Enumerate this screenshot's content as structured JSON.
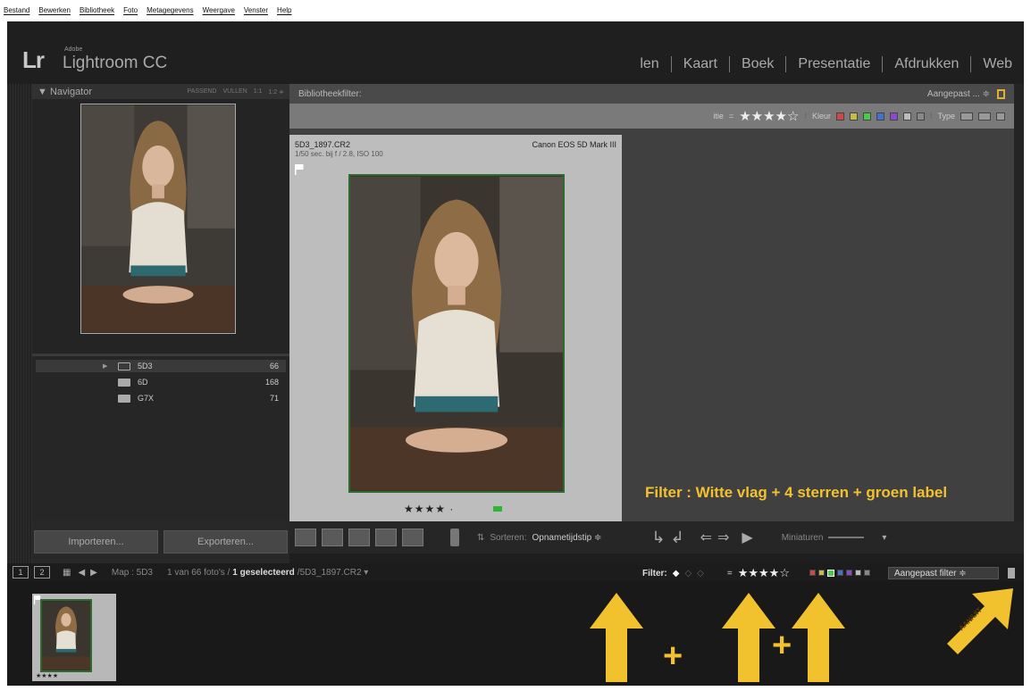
{
  "menu": [
    "Bestand",
    "Bewerken",
    "Bibliotheek",
    "Foto",
    "Metagegevens",
    "Weergave",
    "Venster",
    "Help"
  ],
  "app": {
    "logo": "Lr",
    "adobe": "Adobe",
    "name": "Lightroom CC"
  },
  "modules": [
    "len",
    "Kaart",
    "Boek",
    "Presentatie",
    "Afdrukken",
    "Web"
  ],
  "navigator": {
    "title": "▼ Navigator",
    "opts": [
      "PASSEND",
      "VULLEN",
      "1:1",
      "1:2 ≑"
    ]
  },
  "folders": [
    {
      "name": "5D3",
      "count": "66"
    },
    {
      "name": "6D",
      "count": "168"
    },
    {
      "name": "G7X",
      "count": "71"
    }
  ],
  "buttons": {
    "import": "Importeren...",
    "export": "Exporteren..."
  },
  "filterbar": {
    "label": "Bibliotheekfilter:",
    "preset": "Aangepast ... ≑"
  },
  "filterrow": {
    "attr": "itie",
    "eq": "=",
    "stars": "★★★★☆",
    "kleur": "Kleur",
    "type": "Type"
  },
  "colors": {
    "red": "#c94a4a",
    "yellow": "#c9b84a",
    "green": "#4ac94a",
    "blue": "#4a6fc9",
    "purple": "#8a4ac9",
    "white": "#bbbbbb",
    "gray": "#888888",
    "accent": "#f2c12e",
    "flag_green": "#2fb52f"
  },
  "cell": {
    "name": "5D3_1897.CR2",
    "camera": "Canon EOS 5D Mark III",
    "exif": "1/50 sec. bij f / 2.8, ISO 100",
    "stars": "★★★★ ·"
  },
  "caption": "Filter : Witte vlag + 4 sterren + groen label",
  "toolbar": {
    "sort_label": "Sorteren:",
    "sort_value": "Opnametijdstip ≑",
    "thumb_label": "Miniaturen"
  },
  "filmstrip": {
    "page1": "1",
    "page2": "2",
    "map": "Map : 5D3",
    "count": "1 van 66 foto's /",
    "selected": "1 geselecteerd",
    "file": "/5D3_1897.CR2 ▾",
    "filter_label": "Filter:",
    "eq": "=",
    "stars": "★★★★☆",
    "preset": "Aangepast filter ≑",
    "thumb_stars": "★★★★"
  },
  "annotations": {
    "plus1": "+",
    "plus2": "+",
    "aanuit": "AAN/UIT"
  }
}
